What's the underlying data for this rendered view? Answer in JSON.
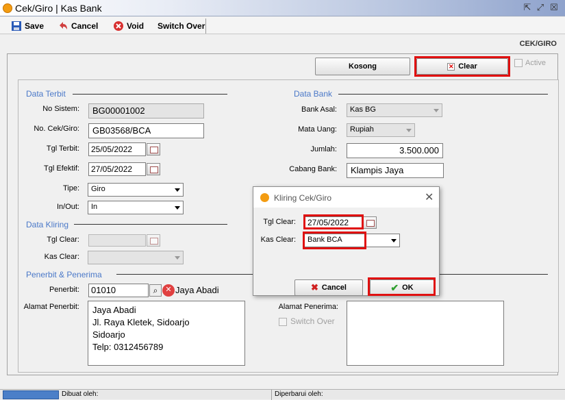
{
  "window": {
    "title": "Cek/Giro | Kas Bank"
  },
  "toolbar": {
    "save": "Save",
    "cancel": "Cancel",
    "void": "Void",
    "switch_over": "Switch Over"
  },
  "header": {
    "label": "CEK/GIRO"
  },
  "actions": {
    "kosong": "Kosong",
    "clear": "Clear",
    "active": "Active"
  },
  "data_terbit": {
    "title": "Data Terbit",
    "no_sistem_label": "No Sistem:",
    "no_sistem": "BG00001002",
    "no_cek_label": "No. Cek/Giro:",
    "no_cek": "GB03568/BCA",
    "tgl_terbit_label": "Tgl Terbit:",
    "tgl_terbit": "25/05/2022",
    "tgl_efektif_label": "Tgl Efektif:",
    "tgl_efektif": "27/05/2022",
    "tipe_label": "Tipe:",
    "tipe": "Giro",
    "inout_label": "In/Out:",
    "inout": "In"
  },
  "data_bank": {
    "title": "Data Bank",
    "bank_asal_label": "Bank Asal:",
    "bank_asal": "Kas BG",
    "mata_uang_label": "Mata Uang:",
    "mata_uang": "Rupiah",
    "jumlah_label": "Jumlah:",
    "jumlah": "3.500.000",
    "cabang_label": "Cabang Bank:",
    "cabang": "Klampis Jaya"
  },
  "data_kliring": {
    "title": "Data Kliring",
    "tgl_clear_label": "Tgl Clear:",
    "kas_clear_label": "Kas Clear:"
  },
  "penerbit": {
    "title": "Penerbit & Penerima",
    "penerbit_label": "Penerbit:",
    "penerbit_code": "01010",
    "penerbit_name": "Jaya Abadi",
    "alamat_label": "Alamat Penerbit:",
    "alamat_lines": [
      "Jaya Abadi",
      "Jl. Raya Kletek, Sidoarjo",
      "Sidoarjo",
      "Telp: 0312456789"
    ],
    "alamat_penerima_label": "Alamat Penerima:",
    "switch_over": "Switch Over"
  },
  "dialog": {
    "title": "Kliring Cek/Giro",
    "tgl_clear_label": "Tgl Clear:",
    "tgl_clear": "27/05/2022",
    "kas_clear_label": "Kas Clear:",
    "kas_clear": "Bank BCA",
    "cancel": "Cancel",
    "ok": "OK"
  },
  "status": {
    "dibuat": "Dibuat oleh:",
    "diperbarui": "Diperbarui oleh:"
  }
}
